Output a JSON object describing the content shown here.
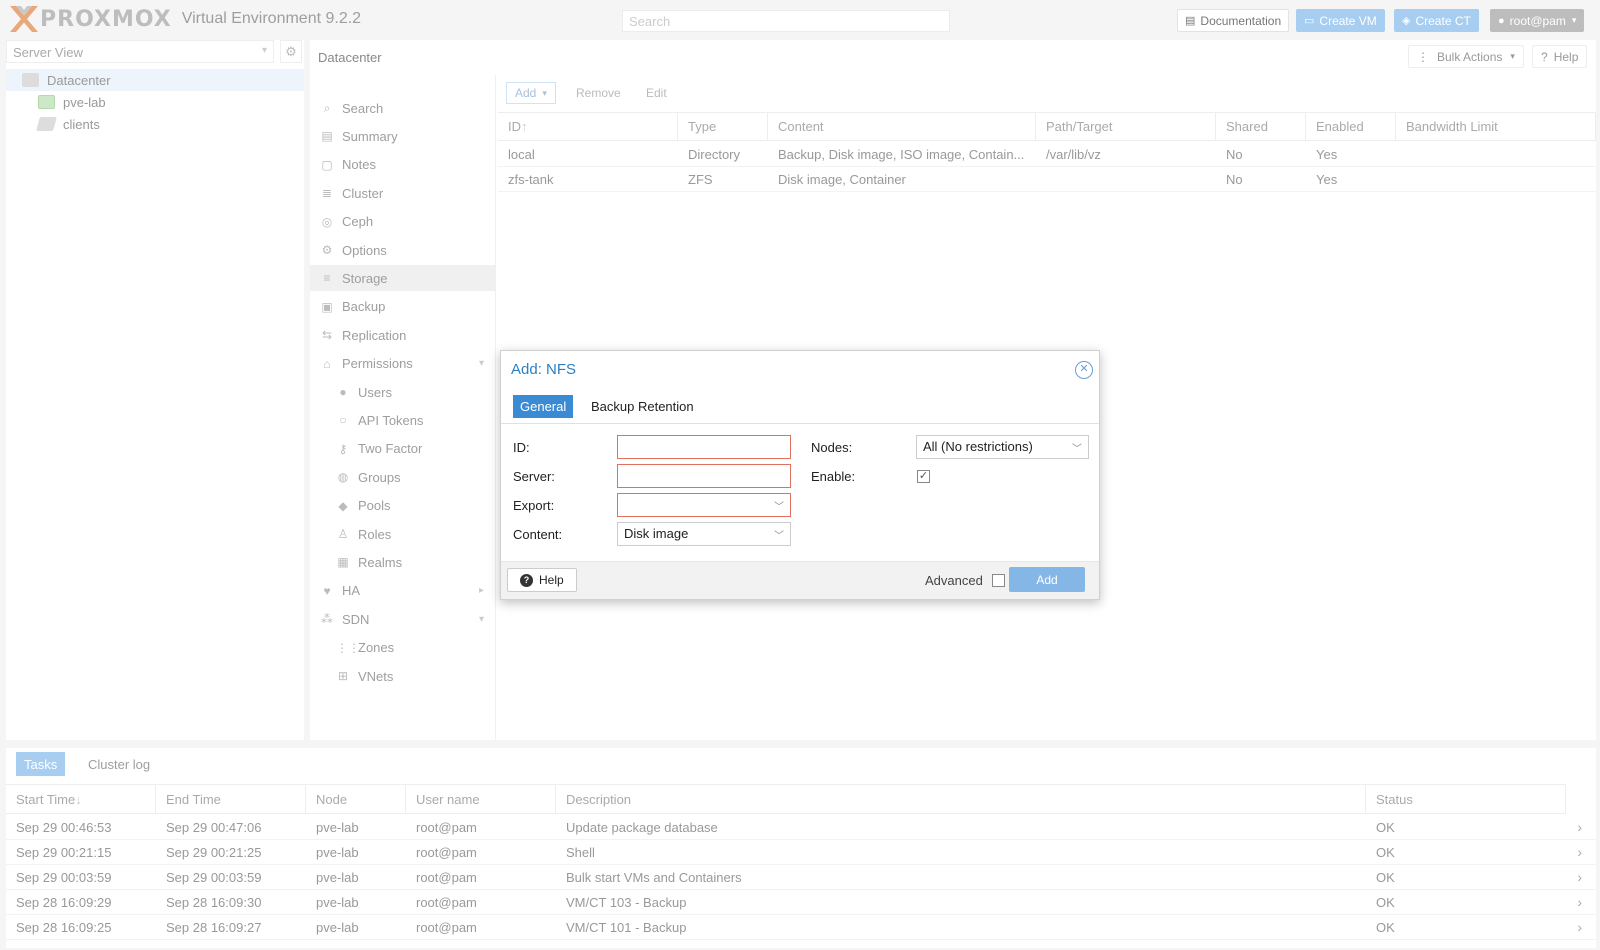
{
  "header": {
    "logo_text": "PROXMOX",
    "version": "Virtual Environment 9.2.2",
    "search_placeholder": "Search",
    "documentation": "Documentation",
    "create_vm": "Create VM",
    "create_ct": "Create CT",
    "user": "root@pam"
  },
  "tree": {
    "view": "Server View",
    "items": [
      "Datacenter",
      "pve-lab",
      "clients"
    ]
  },
  "panel": {
    "title": "Datacenter",
    "bulk_actions": "Bulk Actions",
    "help": "Help"
  },
  "nav": [
    {
      "label": "Search",
      "icon": "search-icon"
    },
    {
      "label": "Summary",
      "icon": "book-icon"
    },
    {
      "label": "Notes",
      "icon": "note-icon"
    },
    {
      "label": "Cluster",
      "icon": "server-icon"
    },
    {
      "label": "Ceph",
      "icon": "ceph-icon"
    },
    {
      "label": "Options",
      "icon": "gear-icon"
    },
    {
      "label": "Storage",
      "icon": "database-icon"
    },
    {
      "label": "Backup",
      "icon": "floppy-icon"
    },
    {
      "label": "Replication",
      "icon": "retweet-icon"
    },
    {
      "label": "Permissions",
      "icon": "unlock-icon"
    },
    {
      "label": "Users",
      "icon": "user-icon"
    },
    {
      "label": "API Tokens",
      "icon": "user-outline-icon"
    },
    {
      "label": "Two Factor",
      "icon": "key-icon"
    },
    {
      "label": "Groups",
      "icon": "users-icon"
    },
    {
      "label": "Pools",
      "icon": "tags-icon"
    },
    {
      "label": "Roles",
      "icon": "male-icon"
    },
    {
      "label": "Realms",
      "icon": "address-book-icon"
    },
    {
      "label": "HA",
      "icon": "heartbeat-icon"
    },
    {
      "label": "SDN",
      "icon": "sdn-icon"
    },
    {
      "label": "Zones",
      "icon": "grid-icon"
    },
    {
      "label": "VNets",
      "icon": "network-icon"
    }
  ],
  "toolbar": {
    "add": "Add",
    "remove": "Remove",
    "edit": "Edit"
  },
  "storage": {
    "columns": [
      "ID",
      "Type",
      "Content",
      "Path/Target",
      "Shared",
      "Enabled",
      "Bandwidth Limit"
    ],
    "rows": [
      [
        "local",
        "Directory",
        "Backup, Disk image, ISO image, Contain...",
        "/var/lib/vz",
        "No",
        "Yes",
        ""
      ],
      [
        "zfs-tank",
        "ZFS",
        "Disk image, Container",
        "",
        "No",
        "Yes",
        ""
      ]
    ]
  },
  "log": {
    "tabs": [
      "Tasks",
      "Cluster log"
    ],
    "columns": [
      "Start Time",
      "End Time",
      "Node",
      "User name",
      "Description",
      "Status"
    ],
    "rows": [
      [
        "Sep 29 00:46:53",
        "Sep 29 00:47:06",
        "pve-lab",
        "root@pam",
        "Update package database",
        "OK"
      ],
      [
        "Sep 29 00:21:15",
        "Sep 29 00:21:25",
        "pve-lab",
        "root@pam",
        "Shell",
        "OK"
      ],
      [
        "Sep 29 00:03:59",
        "Sep 29 00:03:59",
        "pve-lab",
        "root@pam",
        "Bulk start VMs and Containers",
        "OK"
      ],
      [
        "Sep 28 16:09:29",
        "Sep 28 16:09:30",
        "pve-lab",
        "root@pam",
        "VM/CT 103 - Backup",
        "OK"
      ],
      [
        "Sep 28 16:09:25",
        "Sep 28 16:09:27",
        "pve-lab",
        "root@pam",
        "VM/CT 101 - Backup",
        "OK"
      ]
    ]
  },
  "modal": {
    "title": "Add: NFS",
    "tab_general": "General",
    "tab_retention": "Backup Retention",
    "id_label": "ID:",
    "server_label": "Server:",
    "export_label": "Export:",
    "content_label": "Content:",
    "content_value": "Disk image",
    "nodes_label": "Nodes:",
    "nodes_value": "All (No restrictions)",
    "enable_label": "Enable:",
    "help": "Help",
    "advanced": "Advanced",
    "add": "Add"
  }
}
